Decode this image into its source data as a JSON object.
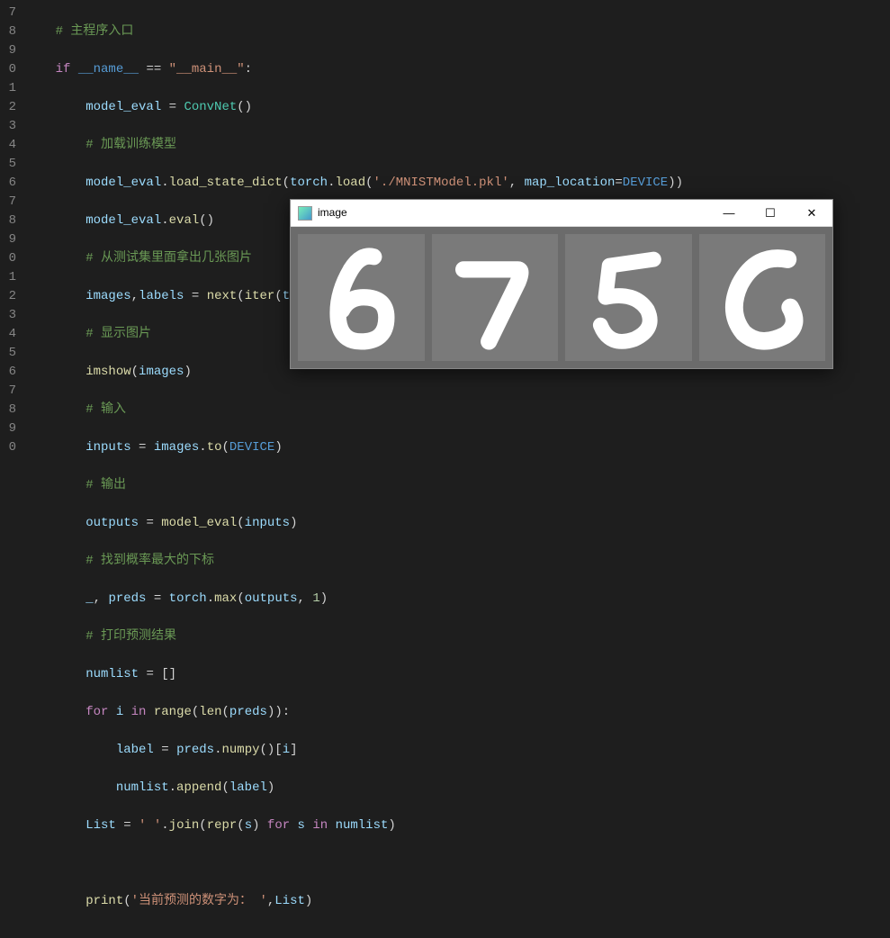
{
  "gutter": [
    "7",
    "8",
    "9",
    "0",
    "1",
    "2",
    "3",
    "4",
    "5",
    "6",
    "7",
    "8",
    "9",
    "0",
    "1",
    "2",
    "3",
    "4",
    "5",
    "6",
    "7",
    "8",
    "9",
    "0"
  ],
  "code": {
    "l0": "# 主程序入口",
    "l1_if": "if",
    "l1_name": "__name__",
    "l1_eq": " == ",
    "l1_main": "\"__main__\"",
    "l2_var": "model_eval",
    "l2_cls": "ConvNet",
    "l3": "# 加载训练模型",
    "l4_me": "model_eval",
    "l4_fn": "load_state_dict",
    "l4_torch": "torch",
    "l4_load": "load",
    "l4_path": "'./MNISTModel.pkl'",
    "l4_map": "map_location",
    "l4_dev": "DEVICE",
    "l5_me": "model_eval",
    "l5_fn": "eval",
    "l6": "# 从测试集里面拿出几张图片",
    "l7_img": "images",
    "l7_lbl": "labels",
    "l7_next": "next",
    "l7_iter": "iter",
    "l7_tl": "test_loader",
    "l8": "# 显示图片",
    "l9_fn": "imshow",
    "l9_arg": "images",
    "l10": "# 输入",
    "l11_in": "inputs",
    "l11_img": "images",
    "l11_to": "to",
    "l11_dev": "DEVICE",
    "l12": "# 输出",
    "l13_out": "outputs",
    "l13_me": "model_eval",
    "l13_in": "inputs",
    "l14": "# 找到概率最大的下标",
    "l15_us": "_",
    "l15_pr": "preds",
    "l15_torch": "torch",
    "l15_max": "max",
    "l15_out": "outputs",
    "l15_one": "1",
    "l16": "# 打印预测结果",
    "l17_nl": "numlist",
    "l18_for": "for",
    "l18_i": "i",
    "l18_in": "in",
    "l18_range": "range",
    "l18_len": "len",
    "l18_pr": "preds",
    "l19_lbl": "label",
    "l19_pr": "preds",
    "l19_np": "numpy",
    "l19_i": "i",
    "l20_nl": "numlist",
    "l20_ap": "append",
    "l20_lbl": "label",
    "l21_L": "List",
    "l21_sp": "' '",
    "l21_join": "join",
    "l21_repr": "repr",
    "l21_s": "s",
    "l21_for": "for",
    "l21_in": "in",
    "l21_nl": "numlist",
    "l23_print": "print",
    "l23_str": "'当前预测的数字为： '",
    "l23_L": "List"
  },
  "window": {
    "title": "image",
    "min": "—",
    "max": "☐",
    "close": "✕"
  },
  "digits": [
    "6",
    "7",
    "5",
    "6"
  ]
}
